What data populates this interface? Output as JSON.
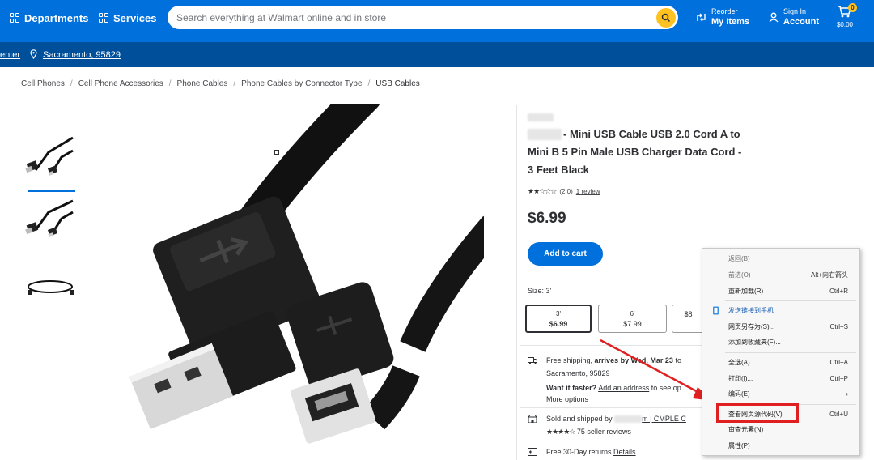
{
  "header": {
    "departments": "Departments",
    "services": "Services",
    "search_placeholder": "Search everything at Walmart online and in store",
    "reorder_small": "Reorder",
    "reorder_big": "My Items",
    "signin_small": "Sign In",
    "signin_big": "Account",
    "cart_count": "0",
    "cart_amount": "$0.00"
  },
  "location_bar": {
    "store_fragment": "enter",
    "separator": "|",
    "location": "Sacramento, 95829"
  },
  "breadcrumbs": [
    "Cell Phones",
    "Cell Phone Accessories",
    "Phone Cables",
    "Phone Cables by Connector Type",
    "USB Cables"
  ],
  "product": {
    "title": "- Mini USB Cable USB 2.0 Cord A to Mini B 5 Pin Male USB Charger Data Cord - 3 Feet Black",
    "rating_stars": "★★☆☆☆",
    "rating_value": "(2.0)",
    "reviews_link": "1 review",
    "price": "$6.99",
    "add_to_cart": "Add to cart",
    "size_label": "Size: 3'",
    "sizes": [
      {
        "size": "3'",
        "price": "$6.99"
      },
      {
        "size": "6'",
        "price": "$7.99"
      },
      {
        "size": "",
        "price": "$8"
      }
    ],
    "shipping": {
      "line1_a": "Free shipping, ",
      "line1_b": "arrives by Wed, Mar 23",
      "line1_c": " to",
      "location_link": "Sacramento, 95829",
      "faster_label": "Want it faster?",
      "address_link": "Add an address",
      "address_tail": " to see op",
      "more_options": "More options",
      "sold_by": "Sold and shipped by ",
      "seller_tail": "m | CMPLE C",
      "seller_stars": "★★★★☆",
      "seller_reviews": "75 seller reviews",
      "returns": "Free 30-Day returns ",
      "details": "Details"
    }
  },
  "context_menu": {
    "items": [
      {
        "label": "返回(B)",
        "shortcut": "",
        "dim": true
      },
      {
        "label": "前进(O)",
        "shortcut": "Alt+向右箭头",
        "dim": true
      },
      {
        "label": "重新加载(R)",
        "shortcut": "Ctrl+R",
        "dim": false
      },
      {
        "label": "发送链接到手机",
        "shortcut": "",
        "dim": false
      },
      {
        "label": "网页另存为(S)...",
        "shortcut": "Ctrl+S",
        "dim": false
      },
      {
        "label": "添加到收藏夹(F)...",
        "shortcut": "",
        "dim": false
      },
      {
        "label": "全选(A)",
        "shortcut": "Ctrl+A",
        "dim": false
      },
      {
        "label": "打印(I)...",
        "shortcut": "Ctrl+P",
        "dim": false
      },
      {
        "label": "编码(E)",
        "shortcut": "›",
        "dim": false
      },
      {
        "label": "查看网页源代码(V)",
        "shortcut": "Ctrl+U",
        "dim": false
      },
      {
        "label": "审查元素(N)",
        "shortcut": "",
        "dim": false
      },
      {
        "label": "属性(P)",
        "shortcut": "",
        "dim": false
      }
    ]
  },
  "colors": {
    "brand_blue": "#0071dc",
    "dark_blue": "#004f9a",
    "spark_yellow": "#ffc220",
    "highlight_red": "#e02020"
  }
}
